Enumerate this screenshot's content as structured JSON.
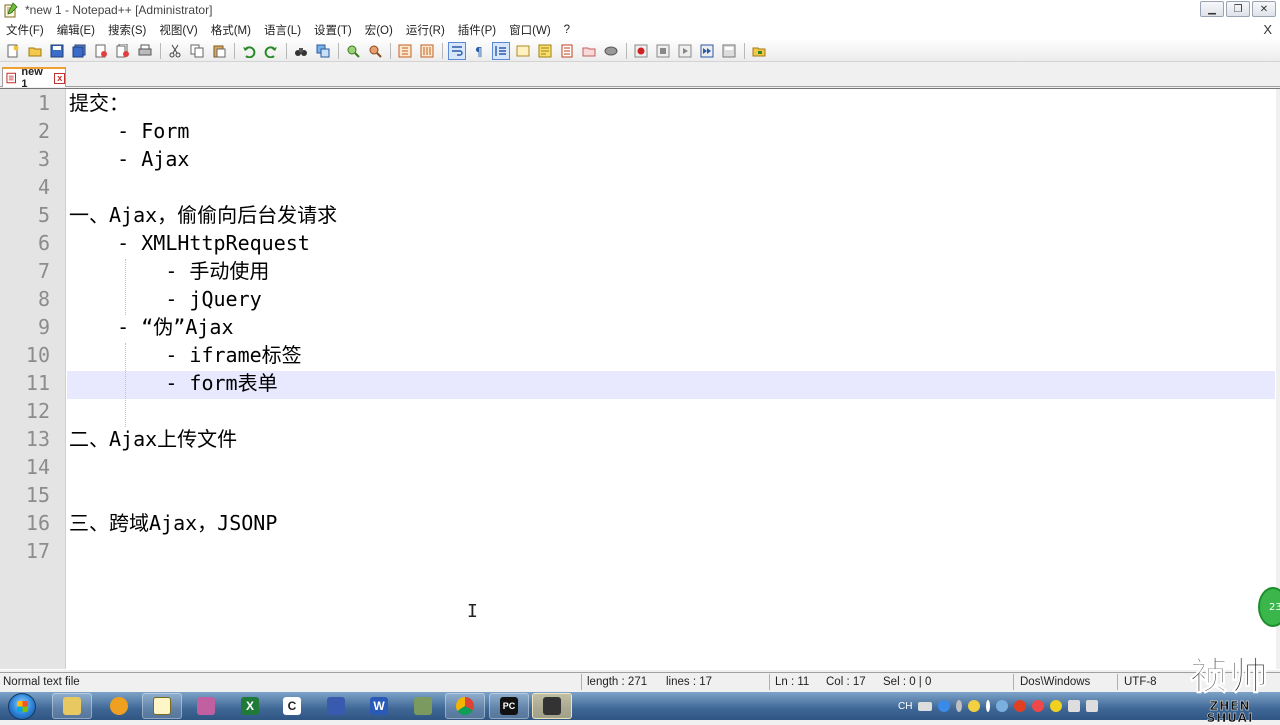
{
  "window": {
    "title": "*new 1 - Notepad++ [Administrator]"
  },
  "menu": {
    "items": [
      "文件(F)",
      "编辑(E)",
      "搜索(S)",
      "视图(V)",
      "格式(M)",
      "语言(L)",
      "设置(T)",
      "宏(O)",
      "运行(R)",
      "插件(P)",
      "窗口(W)",
      "?"
    ],
    "close_label": "X"
  },
  "tab": {
    "label": "new 1",
    "close_label": "x"
  },
  "editor": {
    "lines": [
      {
        "num": "1",
        "text": "提交："
      },
      {
        "num": "2",
        "text": "    - Form"
      },
      {
        "num": "3",
        "text": "    - Ajax"
      },
      {
        "num": "4",
        "text": ""
      },
      {
        "num": "5",
        "text": "一、Ajax，偷偷向后台发请求"
      },
      {
        "num": "6",
        "text": "    - XMLHttpRequest"
      },
      {
        "num": "7",
        "text": "        - 手动使用"
      },
      {
        "num": "8",
        "text": "        - jQuery"
      },
      {
        "num": "9",
        "text": "    - “伪”Ajax"
      },
      {
        "num": "10",
        "text": "        - iframe标签"
      },
      {
        "num": "11",
        "text": "        - form表单"
      },
      {
        "num": "12",
        "text": ""
      },
      {
        "num": "13",
        "text": "二、Ajax上传文件"
      },
      {
        "num": "14",
        "text": ""
      },
      {
        "num": "15",
        "text": ""
      },
      {
        "num": "16",
        "text": "三、跨域Ajax，JSONP"
      },
      {
        "num": "17",
        "text": ""
      }
    ],
    "badge": "23"
  },
  "status": {
    "file_type": "Normal text file",
    "length": "length : 271",
    "lines": "lines : 17",
    "ln": "Ln : 11",
    "col": "Col : 17",
    "sel": "Sel : 0 | 0",
    "eol": "Dos\\Windows",
    "encoding": "UTF-8"
  },
  "taskbar": {
    "tray_lang": "CH"
  },
  "watermark": {
    "cn": "祯帅",
    "en": "ZHEN SHUAI"
  }
}
